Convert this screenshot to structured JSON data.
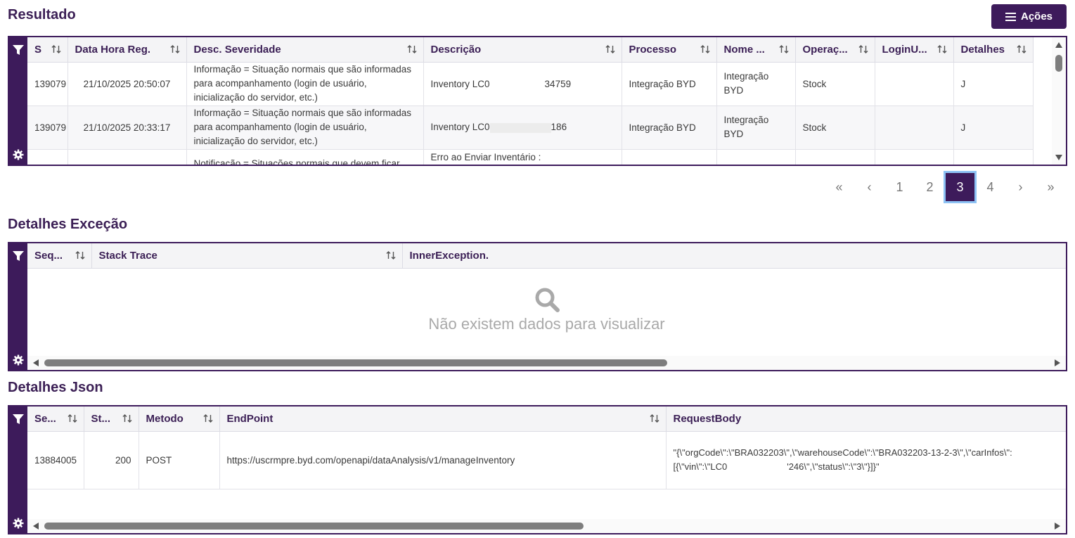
{
  "sections": {
    "resultado": "Resultado",
    "detalhes_excecao": "Detalhes Exceção",
    "detalhes_json": "Detalhes Json"
  },
  "actions_label": "Ações",
  "resultado": {
    "columns": [
      "S",
      "Data Hora Reg.",
      "Desc. Severidade",
      "Descrição",
      "Processo",
      "Nome ...",
      "Operaç...",
      "LoginU...",
      "Detalhes"
    ],
    "rows": [
      {
        "s": "139079",
        "data": "21/10/2025 20:50:07",
        "sev": "Informação = Situação normais que são informadas para acompanhamento (login de usuário, inicialização do servidor, etc.)",
        "desc_a": "Inventory LC0",
        "desc_b": "34759",
        "processo": "Integração BYD",
        "nome": "Integração BYD",
        "operacao": "Stock",
        "login": "",
        "detalhes": "J"
      },
      {
        "s": "139079",
        "data": "21/10/2025 20:33:17",
        "sev": "Informação = Situação normais que são informadas para acompanhamento (login de usuário, inicialização do servidor, etc.)",
        "desc_a": "Inventory LC0",
        "desc_b": "186",
        "processo": "Integração BYD",
        "nome": "Integração BYD",
        "operacao": "Stock",
        "login": "",
        "detalhes": "J"
      },
      {
        "s": "",
        "data": "",
        "sev": "Notificação = Situações normais que devem ficar",
        "desc_a": "Erro ao Enviar Inventário :",
        "desc_b": "",
        "processo": "",
        "nome": "",
        "operacao": "",
        "login": "",
        "detalhes": ""
      }
    ]
  },
  "pagination": {
    "first": "«",
    "prev": "‹",
    "pages": [
      "1",
      "2",
      "3",
      "4"
    ],
    "current_page": "3",
    "next": "›",
    "last": "»"
  },
  "excecao": {
    "columns": [
      "Seq...",
      "Stack Trace",
      "InnerException."
    ],
    "empty_message": "Não existem dados para visualizar"
  },
  "json_grid": {
    "columns": [
      "Se...",
      "St...",
      "Metodo",
      "EndPoint",
      "RequestBody"
    ],
    "rows": [
      {
        "seq": "13884005",
        "status": "200",
        "metodo": "POST",
        "endpoint": "https://uscrmpre.byd.com/openapi/dataAnalysis/v1/manageInventory",
        "body_line1": "\"{\\\"orgCode\\\":\\\"BRA032203\\\",\\\"warehouseCode\\\":\\\"BRA032203-13-2-3\\\",\\\"carInfos\\\":",
        "body_line2_a": "[{\\\"vin\\\":\\\"LC0",
        "body_line2_b": "'246\\\",\\\"status\\\":\\\"3\\\"}]}\""
      }
    ]
  },
  "colors": {
    "primary": "#3d1b5b",
    "active_border": "#8ec3f5"
  }
}
